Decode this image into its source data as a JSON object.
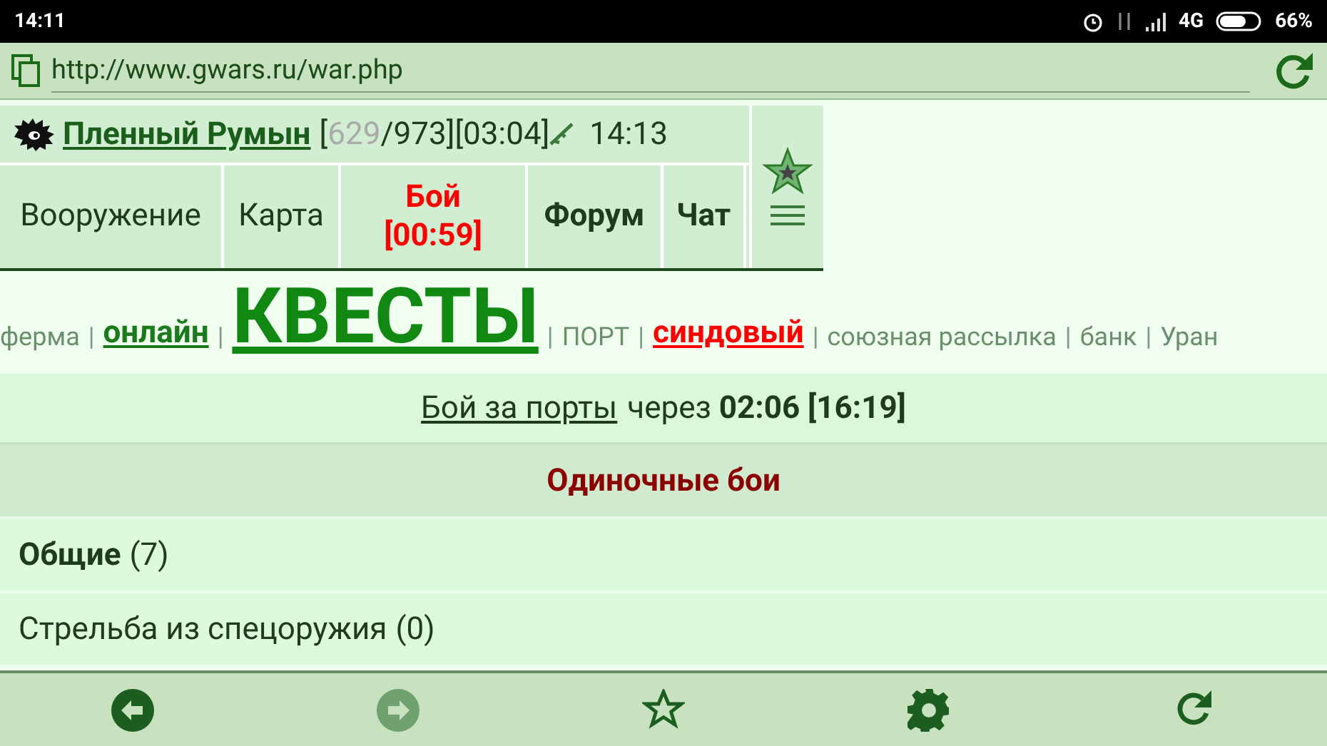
{
  "status_bar": {
    "time": "14:11",
    "network": "4G",
    "battery": "66%"
  },
  "address_bar": {
    "url": "http://www.gwars.ru/war.php"
  },
  "header": {
    "player": "Пленный Румын",
    "stats": [
      {
        "text": "[",
        "dim": false
      },
      {
        "text": "629",
        "dim": true
      },
      {
        "text": "/973][03:04]",
        "dim": false
      }
    ],
    "time": "14:13"
  },
  "nav": [
    {
      "label": "Вооружение",
      "kind": "plain"
    },
    {
      "label": "Карта",
      "kind": "plain"
    },
    {
      "label": "Бой",
      "sub": "[00:59]",
      "kind": "alert"
    },
    {
      "label": "Форум",
      "kind": "bold"
    },
    {
      "label": "Чат",
      "kind": "bold"
    }
  ],
  "links": [
    {
      "text": "ферма",
      "kind": "plain"
    },
    {
      "text": "|",
      "kind": "separator"
    },
    {
      "text": "онлайн",
      "kind": "bold_link"
    },
    {
      "text": "|",
      "kind": "separator"
    },
    {
      "text": "КВЕСТЫ",
      "kind": "big_link"
    },
    {
      "text": "|",
      "kind": "separator"
    },
    {
      "text": "ПОРТ",
      "kind": "plain"
    },
    {
      "text": "|",
      "kind": "separator"
    },
    {
      "text": "синдовый",
      "kind": "red_link"
    },
    {
      "text": "|",
      "kind": "separator"
    },
    {
      "text": "союзная рассылка",
      "kind": "plain"
    },
    {
      "text": "|",
      "kind": "separator"
    },
    {
      "text": "банк",
      "kind": "plain"
    },
    {
      "text": "|",
      "kind": "separator"
    },
    {
      "text": "Уран",
      "kind": "plain"
    }
  ],
  "announcement": {
    "link": "Бой за порты",
    "text": "через **02:06 [16:19]**"
  },
  "section": {
    "title": "Одиночные бои",
    "rows": [
      {
        "label": "Общие",
        "bold": true,
        "count": "(7)"
      },
      {
        "label": "Стрельба из спецоружия",
        "bold": false,
        "count": "(0)"
      }
    ]
  },
  "toolbar": [
    {
      "kind": "back",
      "disabled": false
    },
    {
      "kind": "forward",
      "disabled": true
    },
    {
      "kind": "star",
      "disabled": false
    },
    {
      "kind": "settings",
      "disabled": false
    },
    {
      "kind": "reload",
      "disabled": false
    }
  ]
}
